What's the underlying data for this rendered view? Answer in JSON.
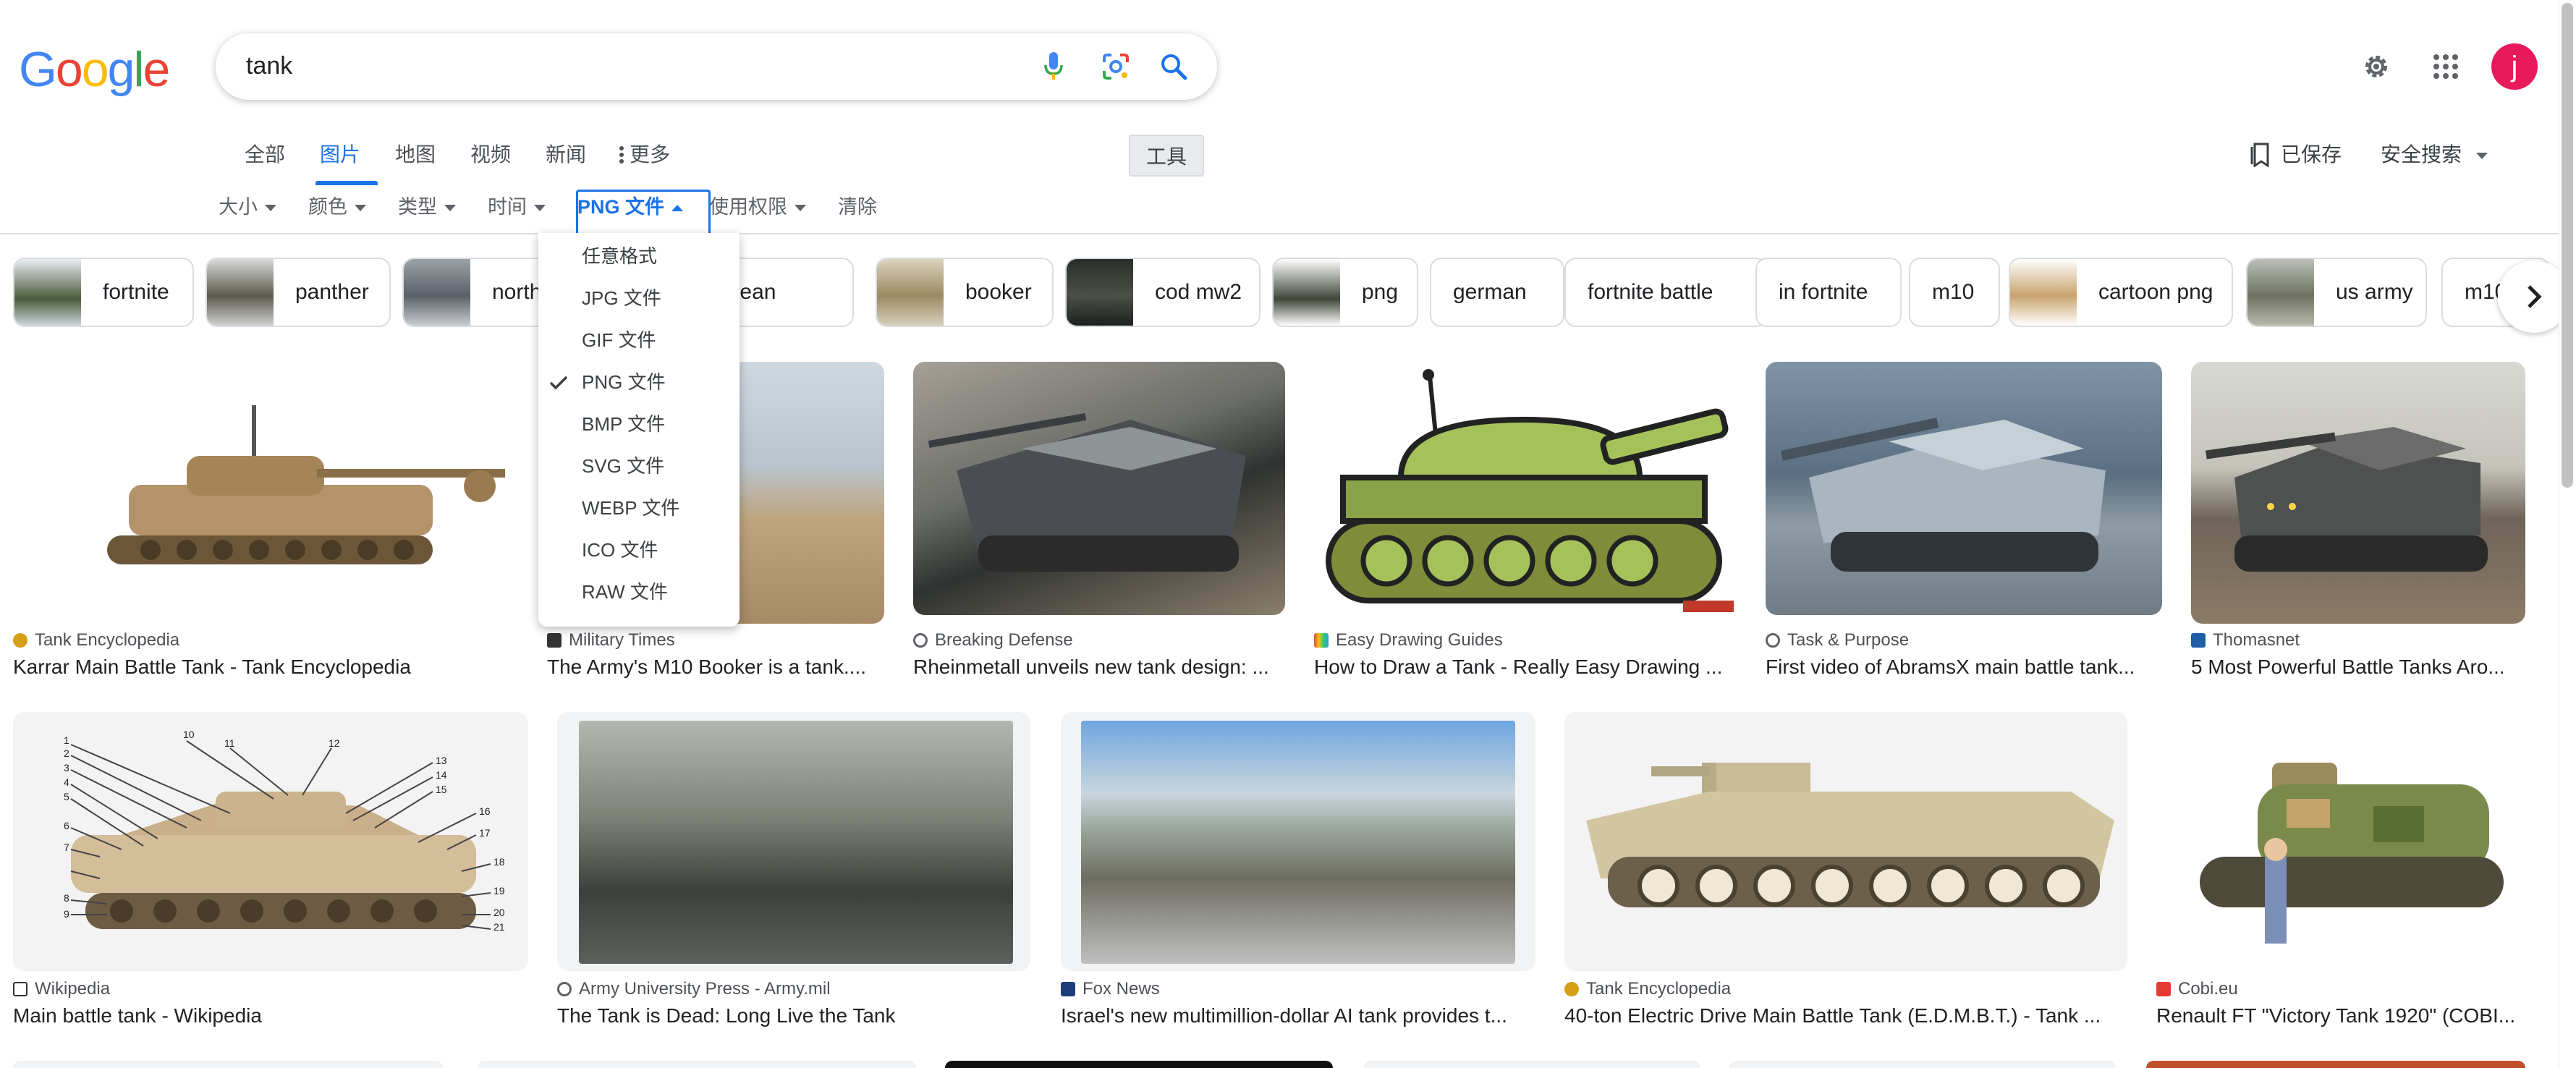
{
  "header": {
    "logo_letters": [
      "G",
      "o",
      "o",
      "g",
      "l",
      "e"
    ],
    "logo_colors": [
      "#4285f4",
      "#ea4335",
      "#fbbc05",
      "#4285f4",
      "#34a853",
      "#ea4335"
    ],
    "search_value": "tank",
    "avatar_letter": "j",
    "avatar_color": "#e8195a"
  },
  "tabs": {
    "all": "全部",
    "images": "图片",
    "maps": "地图",
    "videos": "视频",
    "news": "新闻",
    "more": "更多",
    "tools": "工具",
    "saved": "已保存",
    "safe_search": "安全搜索"
  },
  "filters": {
    "size": "大小",
    "color": "颜色",
    "type": "类型",
    "time": "时间",
    "format": "PNG 文件",
    "license": "使用权限",
    "clear": "清除"
  },
  "format_menu": {
    "items": [
      "任意格式",
      "JPG 文件",
      "GIF 文件",
      "PNG 文件",
      "BMP 文件",
      "SVG 文件",
      "WEBP 文件",
      "ICO 文件",
      "RAW 文件"
    ],
    "selected": "PNG 文件"
  },
  "chips": [
    "fortnite",
    "panther",
    "north",
    "north korean",
    "booker",
    "cod mw2",
    "png",
    "german",
    "fortnite battle",
    "in fortnite",
    "m10",
    "cartoon png",
    "us army",
    "m10"
  ],
  "results_row1": [
    {
      "source": "Tank Encyclopedia",
      "title": "Karrar Main Battle Tank - Tank Encyclopedia"
    },
    {
      "source": "Military Times",
      "title": "The Army's M10 Booker is a tank...."
    },
    {
      "source": "Breaking Defense",
      "title": "Rheinmetall unveils new tank design: ..."
    },
    {
      "source": "Easy Drawing Guides",
      "title": "How to Draw a Tank - Really Easy Drawing ..."
    },
    {
      "source": "Task & Purpose",
      "title": "First video of AbramsX main battle tank..."
    },
    {
      "source": "Thomasnet",
      "title": "5 Most Powerful Battle Tanks Aro..."
    }
  ],
  "results_row2": [
    {
      "source": "Wikipedia",
      "title": "Main battle tank - Wikipedia"
    },
    {
      "source": "Army University Press - Army.mil",
      "title": "The Tank is Dead: Long Live the Tank"
    },
    {
      "source": "Fox News",
      "title": "Israel's new multimillion-dollar AI tank provides t..."
    },
    {
      "source": "Tank Encyclopedia",
      "title": "40-ton Electric Drive Main Battle Tank (E.D.M.B.T.) - Tank ..."
    },
    {
      "source": "Cobi.eu",
      "title": "Renault FT \"Victory Tank 1920\" (COBI..."
    }
  ],
  "diagram_labels": [
    "1",
    "2",
    "3",
    "4",
    "5",
    "6",
    "7",
    "8",
    "9",
    "10",
    "11",
    "12",
    "13",
    "14",
    "15",
    "16",
    "17",
    "18",
    "19",
    "20",
    "21"
  ]
}
